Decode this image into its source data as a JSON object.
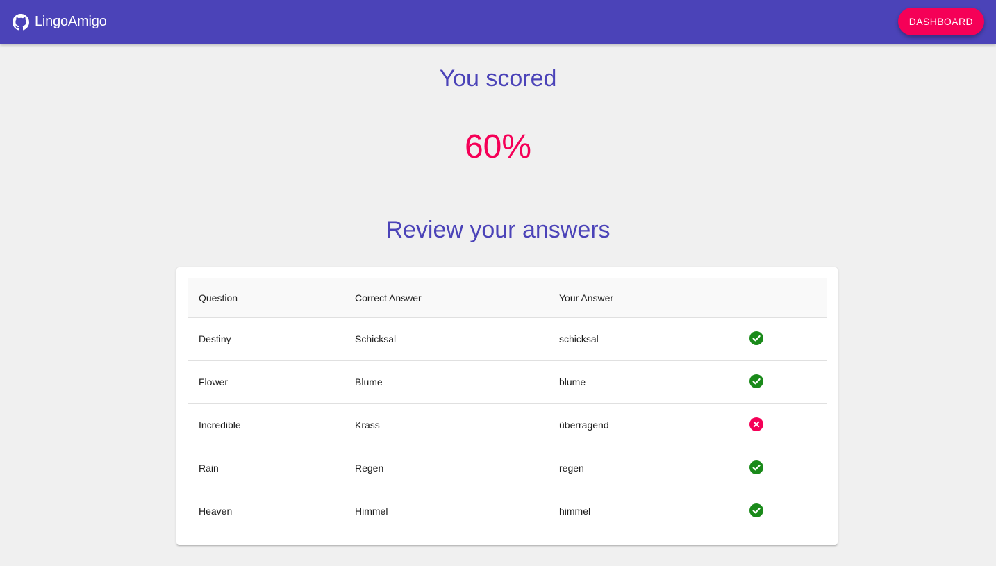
{
  "appbar": {
    "brand_name": "LingoAmigo",
    "brand_icon": "github-icon",
    "dashboard_label": "DASHBOARD"
  },
  "result": {
    "title": "You scored",
    "score": "60%"
  },
  "review": {
    "title": "Review your answers",
    "columns": [
      "Question",
      "Correct Answer",
      "Your Answer",
      ""
    ],
    "rows": [
      {
        "question": "Destiny",
        "correct": "Schicksal",
        "answer": "schicksal",
        "status": "correct"
      },
      {
        "question": "Flower",
        "correct": "Blume",
        "answer": "blume",
        "status": "correct"
      },
      {
        "question": "Incredible",
        "correct": "Krass",
        "answer": "überragend",
        "status": "incorrect"
      },
      {
        "question": "Rain",
        "correct": "Regen",
        "answer": "regen",
        "status": "correct"
      },
      {
        "question": "Heaven",
        "correct": "Himmel",
        "answer": "himmel",
        "status": "correct"
      }
    ]
  },
  "colors": {
    "primary": "#4b43b8",
    "accent": "#f50057",
    "correct": "#1a8a1a",
    "incorrect": "#f50057"
  }
}
